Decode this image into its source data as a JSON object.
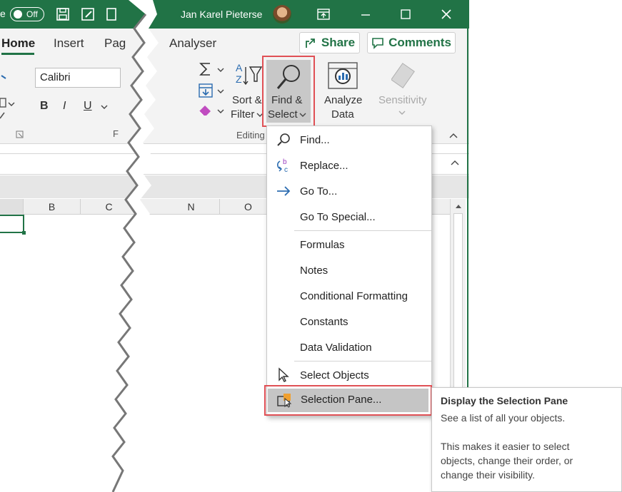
{
  "titlebar": {
    "autosave_suffix": "e",
    "toggle_label": "Off",
    "user_name": "Jan Karel Pieterse",
    "bg_color": "#217346"
  },
  "tabs": {
    "home": "Home",
    "insert": "Insert",
    "page_partial": "Pag",
    "analyser": "Analyser",
    "share": "Share",
    "comments": "Comments"
  },
  "ribbon": {
    "font_name": "Calibri",
    "bold": "B",
    "italic": "I",
    "underline": "U",
    "font_group_partial": "F",
    "sort_filter": [
      "Sort &",
      "Filter"
    ],
    "find_select": [
      "Find &",
      "Select"
    ],
    "analyze_data": [
      "Analyze",
      "Data"
    ],
    "sensitivity": "Sensitivity",
    "editing_group": "Editing"
  },
  "grid": {
    "columns": [
      "B",
      "C",
      "N",
      "O"
    ]
  },
  "menu": {
    "items": [
      {
        "label": "Find...",
        "icon": "magnifier-icon"
      },
      {
        "label": "Replace...",
        "icon": "replace-icon"
      },
      {
        "label": "Go To...",
        "icon": "arrow-right-icon"
      },
      {
        "label": "Go To Special...",
        "icon": ""
      },
      {
        "label": "Formulas",
        "icon": ""
      },
      {
        "label": "Notes",
        "icon": ""
      },
      {
        "label": "Conditional Formatting",
        "icon": ""
      },
      {
        "label": "Constants",
        "icon": ""
      },
      {
        "label": "Data Validation",
        "icon": ""
      },
      {
        "label": "Select Objects",
        "icon": "cursor-icon"
      },
      {
        "label": "Selection Pane...",
        "icon": "selection-pane-icon"
      }
    ]
  },
  "tooltip": {
    "title": "Display the Selection Pane",
    "line1": "See a list of all your objects.",
    "line2": "This makes it easier to select",
    "line3": "objects, change their order, or",
    "line4": "change their visibility."
  },
  "colors": {
    "accent": "#217346",
    "highlight_outline": "#e05055"
  }
}
